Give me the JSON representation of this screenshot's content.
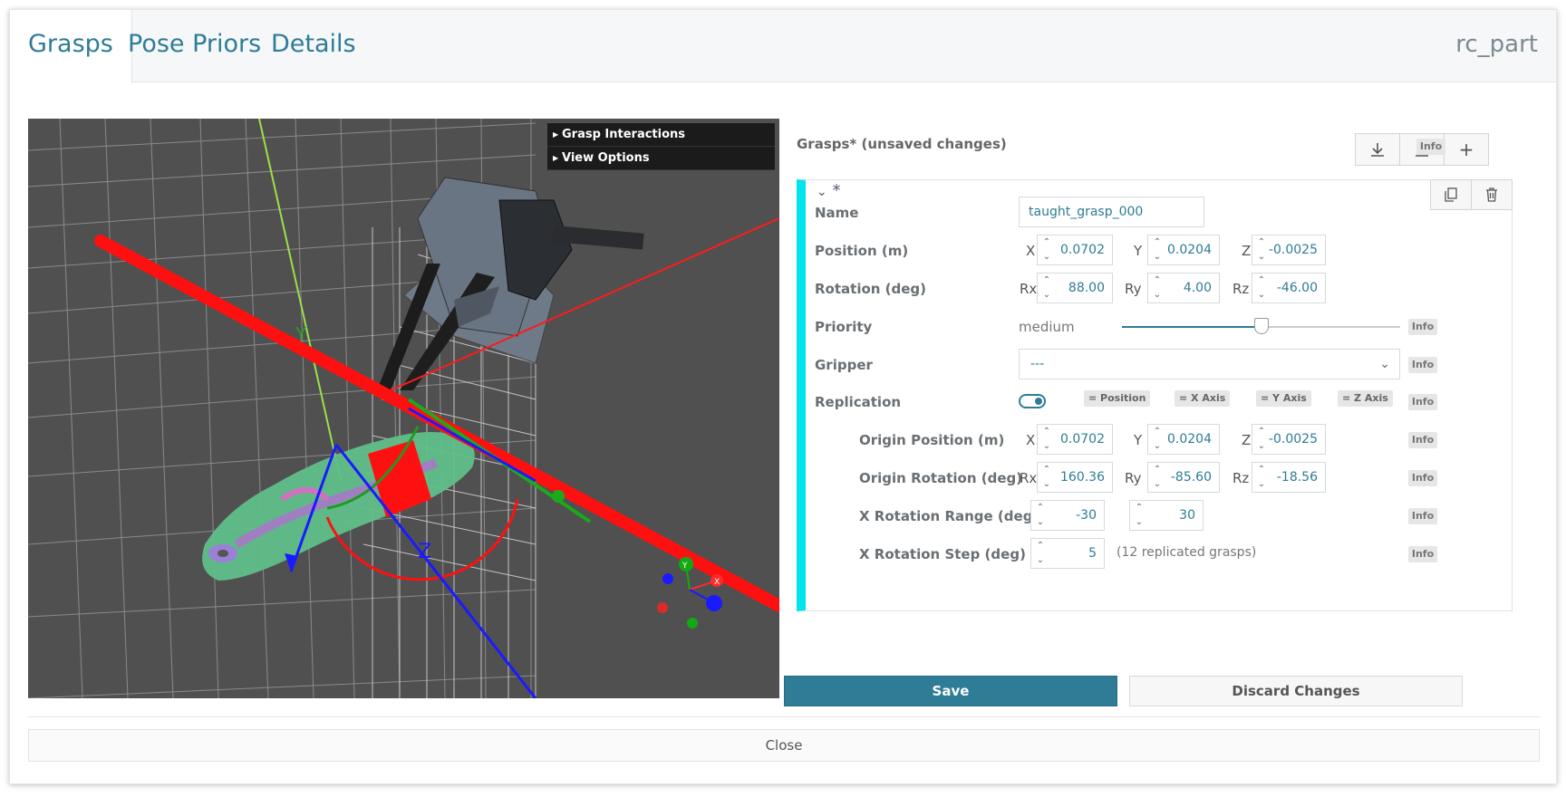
{
  "tabs": [
    {
      "label": "Grasps",
      "active": true
    },
    {
      "label": "Pose Priors",
      "active": false
    },
    {
      "label": "Details",
      "active": false
    }
  ],
  "modal_title": "rc_part",
  "viewer": {
    "menu": [
      {
        "label": "Grasp Interactions"
      },
      {
        "label": "View Options"
      }
    ],
    "axis_labels": {
      "y": "Y",
      "z": "Z",
      "mini_y": "Y",
      "mini_x": "X"
    }
  },
  "grasps_panel": {
    "title": "Grasps* (unsaved changes)",
    "info_label": "Info",
    "toolbar_icons": [
      "download-icon",
      "upload-icon",
      "plus-icon"
    ],
    "card": {
      "header": "*",
      "header_icons": [
        "chevron-down-icon",
        "copy-icon",
        "trash-icon"
      ],
      "name": {
        "label": "Name",
        "value": "taught_grasp_000"
      },
      "position": {
        "label": "Position (m)",
        "x_label": "X",
        "x": "0.0702",
        "y_label": "Y",
        "y": "0.0204",
        "z_label": "Z",
        "z": "-0.0025"
      },
      "rotation": {
        "label": "Rotation (deg)",
        "rx_label": "Rx",
        "rx": "88.00",
        "ry_label": "Ry",
        "ry": "4.00",
        "rz_label": "Rz",
        "rz": "-46.00"
      },
      "priority": {
        "label": "Priority",
        "value": "medium",
        "level": 0.5
      },
      "gripper": {
        "label": "Gripper",
        "value": "---"
      },
      "replication": {
        "label": "Replication",
        "enabled": true,
        "chips": [
          "= Position",
          "= X Axis",
          "= Y Axis",
          "= Z Axis"
        ],
        "origin_position": {
          "label": "Origin Position (m)",
          "x_label": "X",
          "x": "0.0702",
          "y_label": "Y",
          "y": "0.0204",
          "z_label": "Z",
          "z": "-0.0025"
        },
        "origin_rotation": {
          "label": "Origin Rotation (deg)",
          "rx_label": "Rx",
          "rx": "160.36",
          "ry_label": "Ry",
          "ry": "-85.60",
          "rz_label": "Rz",
          "rz": "-18.56"
        },
        "x_rotation_range": {
          "label": "X Rotation Range (deg)",
          "min": "-30",
          "max": "30"
        },
        "x_rotation_step": {
          "label": "X Rotation Step (deg)",
          "value": "5",
          "note": "(12 replicated grasps)"
        }
      }
    },
    "save_label": "Save",
    "discard_label": "Discard Changes"
  },
  "close_label": "Close",
  "colors": {
    "accent": "#2f7c96",
    "card_bar": "#00e5ee",
    "viewer_bg": "#505050"
  }
}
